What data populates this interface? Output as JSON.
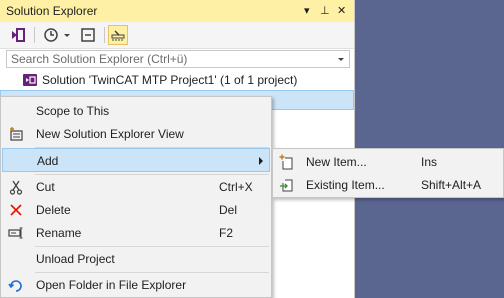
{
  "window": {
    "title": "Solution Explorer",
    "controls": {
      "dropdown": "▾",
      "pin": "⊥",
      "close": "✕"
    }
  },
  "toolbar": {
    "buttons": [
      "vs-switch-views-icon",
      "history-icon",
      "collapse-all-icon",
      "properties-icon"
    ]
  },
  "search": {
    "placeholder": "Search Solution Explorer (Ctrl+ü)"
  },
  "tree": {
    "solution_label": "Solution 'TwinCAT MTP Project1' (1 of 1 project)"
  },
  "context_menu": {
    "items": [
      {
        "label": "Scope to This",
        "shortcut": "",
        "icon": ""
      },
      {
        "label": "New Solution Explorer View",
        "shortcut": "",
        "icon": "new-view-icon"
      },
      {
        "label": "Add",
        "shortcut": "",
        "icon": "",
        "submenu": true,
        "highlighted": true
      },
      {
        "label": "Cut",
        "shortcut": "Ctrl+X",
        "icon": "scissors-icon"
      },
      {
        "label": "Delete",
        "shortcut": "Del",
        "icon": "delete-x-icon"
      },
      {
        "label": "Rename",
        "shortcut": "F2",
        "icon": "rename-icon"
      },
      {
        "label": "Unload Project",
        "shortcut": "",
        "icon": ""
      },
      {
        "label": "Open Folder in File Explorer",
        "shortcut": "",
        "icon": "open-folder-icon"
      }
    ]
  },
  "add_submenu": {
    "items": [
      {
        "label": "New Item...",
        "shortcut": "Ins",
        "icon": "new-item-icon"
      },
      {
        "label": "Existing Item...",
        "shortcut": "Shift+Alt+A",
        "icon": "existing-item-icon"
      }
    ]
  },
  "colors": {
    "titlebar": "#fef0a5",
    "background": "#5a6590",
    "menu_highlight": "#cce4f7",
    "accent_purple": "#68217a",
    "delete_red": "#e51400"
  }
}
